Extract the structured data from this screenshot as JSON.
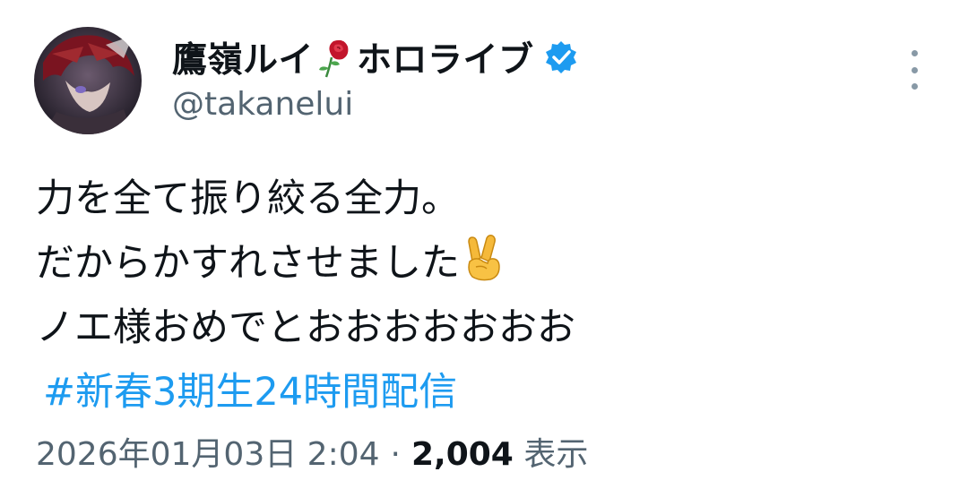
{
  "author": {
    "display_name": "鷹嶺ルイ",
    "display_name_suffix": "ホロライブ",
    "handle": "@takanelui",
    "name_emoji": "rose-icon",
    "verified": true,
    "verified_icon": "verified-badge-icon",
    "avatar": "avatar-image"
  },
  "tweet": {
    "lines": [
      "力を全て振り絞る全力。",
      "だからかすれさせました",
      "ノエ様おめでとおおおおおおお"
    ],
    "line2_emoji": "victory-hand-emoji",
    "hashtag": "#新春3期生24時間配信"
  },
  "meta": {
    "timestamp": "2026年01月03日 2:04",
    "separator": "·",
    "views_count": "2,004",
    "views_label": "表示"
  },
  "menu": {
    "more_icon": "more-vertical-icon"
  },
  "colors": {
    "text": "#0f1419",
    "secondary": "#536471",
    "link": "#1d9bf0",
    "verified": "#1d9bf0"
  }
}
